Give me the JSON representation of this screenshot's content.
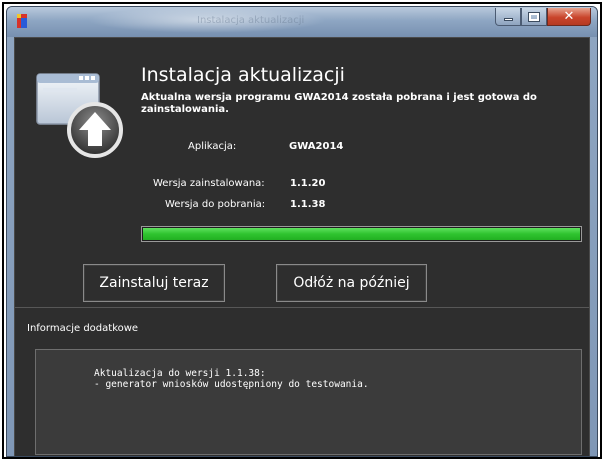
{
  "window": {
    "title": "Instalacja aktualizacji",
    "app_icon": "gwa-app-icon",
    "controls": {
      "minimize_icon": "minimize-icon",
      "maximize_icon": "maximize-icon",
      "close_icon": "close-icon",
      "close_glyph": "✕"
    }
  },
  "header": {
    "icon": "update-arrow-icon",
    "title": "Instalacja aktualizacji",
    "subtitle": "Aktualna wersja programu GWA2014 została pobrana i jest gotowa do zainstalowania."
  },
  "details": {
    "application_label": "Aplikacja:",
    "application_value": "GWA2014",
    "installed_label": "Wersja zainstalowana:",
    "installed_value": "1.1.20",
    "download_label": "Wersja do pobrania:",
    "download_value": "1.1.38"
  },
  "progress": {
    "percent": 100,
    "color": "#2fc42f"
  },
  "actions": {
    "install_now": "Zainstaluj teraz",
    "postpone": "Odłóż na później"
  },
  "additional_info": {
    "label": "Informacje dodatkowe",
    "lines": [
      "Aktualizacja do wersji 1.1.38:",
      "- generator wniosków udostępniony do testowania."
    ]
  },
  "colors": {
    "background": "#2e2e2e",
    "accent_green": "#2fc42f",
    "text": "#ffffff"
  }
}
